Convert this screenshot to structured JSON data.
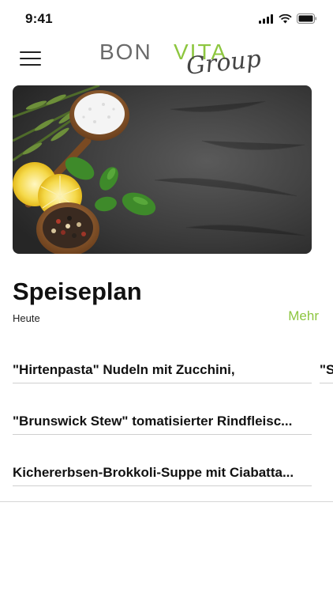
{
  "status_bar": {
    "time": "9:41"
  },
  "header": {
    "logo_left": "BON",
    "logo_right": "VITA",
    "logo_script": "Group"
  },
  "section": {
    "title": "Speiseplan",
    "subtitle": "Heute",
    "more_label": "Mehr"
  },
  "menu_items": [
    {
      "label": "\"Hirtenpasta\" Nudeln mit Zucchini,"
    },
    {
      "label": "\"Brunswick Stew\" tomatisierter Rindfleisc..."
    },
    {
      "label": "Kichererbsen-Brokkoli-Suppe mit Ciabatta..."
    }
  ],
  "next_card_peek": {
    "label": "\"S"
  },
  "colors": {
    "accent": "#8dc63f",
    "text": "#111111",
    "divider": "#cfcfcf"
  },
  "icons": {
    "menu": "hamburger-icon",
    "signal": "signal-icon",
    "wifi": "wifi-icon",
    "battery": "battery-icon"
  }
}
